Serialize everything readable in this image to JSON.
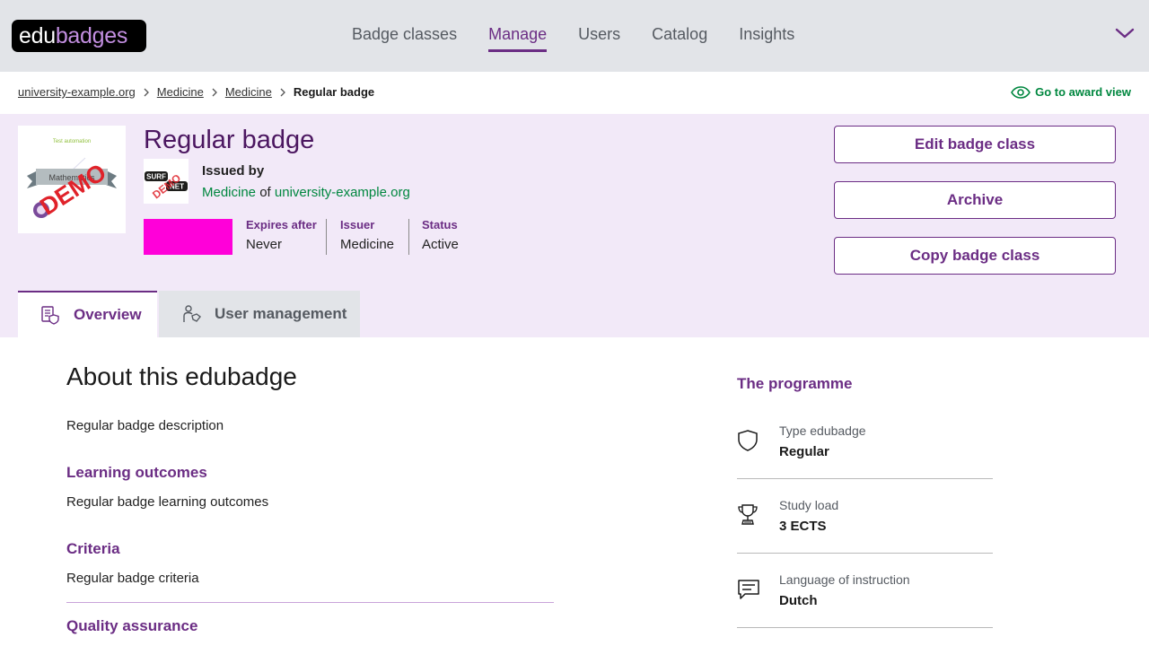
{
  "header": {
    "logo": {
      "part1": "edu",
      "part2": "badges"
    },
    "nav": [
      {
        "label": "Badge classes",
        "active": false
      },
      {
        "label": "Manage",
        "active": true
      },
      {
        "label": "Users",
        "active": false
      },
      {
        "label": "Catalog",
        "active": false
      },
      {
        "label": "Insights",
        "active": false
      }
    ],
    "menu_icon": "chevron-down-icon"
  },
  "breadcrumb": {
    "items": [
      "university-example.org",
      "Medicine",
      "Medicine"
    ],
    "current": "Regular badge",
    "award_view_label": "Go to award view"
  },
  "badge": {
    "title": "Regular badge",
    "image_text": {
      "top": "Test automation",
      "ribbon": "Mathematics",
      "stamp": "DEMO"
    },
    "issuer_logo": {
      "line1": "SURF",
      "line2": "NET",
      "stamp": "DEMO"
    },
    "issued_by_label": "Issued by",
    "issued_by": {
      "faculty": "Medicine",
      "of": "of",
      "institution": "university-example.org"
    },
    "color": "#ff00d9",
    "meta": [
      {
        "label": "Expires after",
        "value": "Never"
      },
      {
        "label": "Issuer",
        "value": "Medicine"
      },
      {
        "label": "Status",
        "value": "Active"
      }
    ]
  },
  "actions": {
    "edit": "Edit badge class",
    "archive": "Archive",
    "copy": "Copy badge class"
  },
  "tabs": [
    {
      "label": "Overview",
      "icon": "overview-icon",
      "active": true
    },
    {
      "label": "User management",
      "icon": "user-management-icon",
      "active": false
    }
  ],
  "about": {
    "title": "About this edubadge",
    "description": "Regular badge description",
    "learning_outcomes_title": "Learning outcomes",
    "learning_outcomes": "Regular badge learning outcomes",
    "criteria_title": "Criteria",
    "criteria": "Regular badge criteria",
    "quality_title": "Quality assurance"
  },
  "programme": {
    "title": "The programme",
    "items": [
      {
        "icon": "shield-icon",
        "label": "Type edubadge",
        "value": "Regular"
      },
      {
        "icon": "trophy-icon",
        "label": "Study load",
        "value": "3 ECTS"
      },
      {
        "icon": "chat-icon",
        "label": "Language of instruction",
        "value": "Dutch"
      }
    ]
  },
  "colors": {
    "brand": "#6b2d84",
    "link_green": "#00873f",
    "hero_bg": "#f2e9f8",
    "header_bg": "#e2e4e8"
  }
}
